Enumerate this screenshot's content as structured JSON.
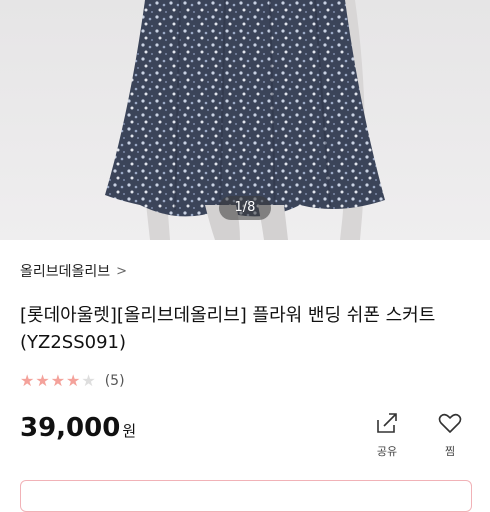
{
  "gallery": {
    "counter": "1/8"
  },
  "product": {
    "brand_link": "올리브데올리브",
    "title": "[롯데아울렛][올리브데올리브] 플라워 밴딩 쉬폰 스커트 (YZ2SS091)",
    "rating": {
      "stars": 4,
      "max": 5,
      "review_count": "(5)"
    },
    "price": "39,000",
    "price_unit": "원"
  },
  "actions": {
    "share_label": "공유",
    "wish_label": "찜"
  },
  "colors": {
    "star_filled": "#f4a29b",
    "star_empty": "#dedede",
    "accent_border": "#f1b2b7"
  }
}
